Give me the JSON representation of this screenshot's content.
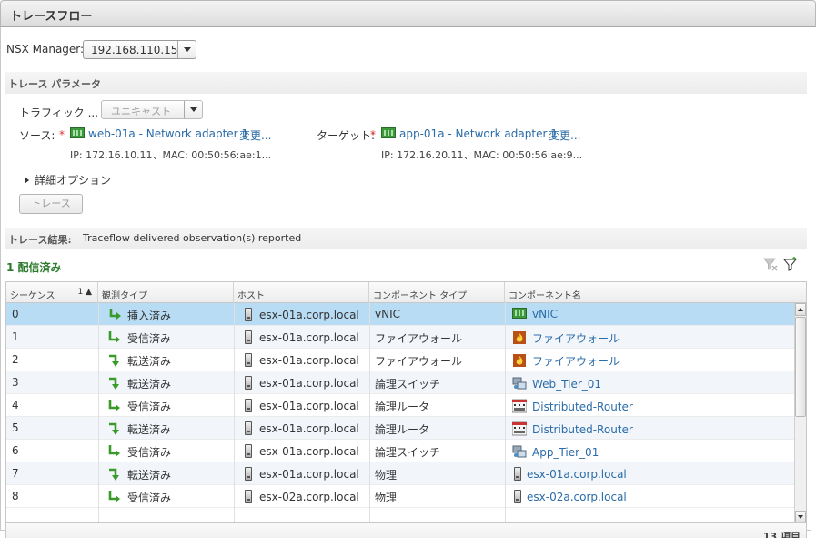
{
  "window": {
    "title": "トレースフロー"
  },
  "nsx": {
    "label": "NSX Manager:",
    "value": "192.168.110.15"
  },
  "params": {
    "section_title": "トレース パラメータ",
    "traffic_label": "トラフィック ...",
    "traffic_value": "ユニキャスト",
    "source_label": "ソース:",
    "source_required": "*",
    "source_link": "web-01a - Network adapter 1",
    "source_change": "変更...",
    "source_info": "IP: 172.16.10.11、MAC: 00:50:56:ae:1...",
    "target_label": "ターゲット:",
    "target_required": "*",
    "target_link": "app-01a - Network adapter 1",
    "target_change": "変更...",
    "target_info": "IP: 172.16.20.11、MAC: 00:50:56:ae:9...",
    "advanced_label": "詳細オプション",
    "trace_button": "トレース"
  },
  "results": {
    "label": "トレース結果:",
    "value": "Traceflow delivered observation(s) reported",
    "delivered": "1 配信済み"
  },
  "grid": {
    "columns": [
      "シーケンス",
      "観測タイプ",
      "ホスト",
      "コンポーネント タイプ",
      "コンポーネント名"
    ],
    "sort_indicator": "1 ▲",
    "rows": [
      {
        "seq": "0",
        "obs": "挿入済み",
        "obs_kind": "inject",
        "host": "esx-01a.corp.local",
        "ctype": "vNIC",
        "cname": "vNIC",
        "cicon": "vnic-icon"
      },
      {
        "seq": "1",
        "obs": "受信済み",
        "obs_kind": "receive",
        "host": "esx-01a.corp.local",
        "ctype": "ファイアウォール",
        "cname": "ファイアウォール",
        "cicon": "firewall-icon"
      },
      {
        "seq": "2",
        "obs": "転送済み",
        "obs_kind": "forward",
        "host": "esx-01a.corp.local",
        "ctype": "ファイアウォール",
        "cname": "ファイアウォール",
        "cicon": "firewall-icon"
      },
      {
        "seq": "3",
        "obs": "転送済み",
        "obs_kind": "forward",
        "host": "esx-01a.corp.local",
        "ctype": "論理スイッチ",
        "cname": "Web_Tier_01",
        "cicon": "logical-switch-icon"
      },
      {
        "seq": "4",
        "obs": "受信済み",
        "obs_kind": "receive",
        "host": "esx-01a.corp.local",
        "ctype": "論理ルータ",
        "cname": "Distributed-Router",
        "cicon": "router-icon"
      },
      {
        "seq": "5",
        "obs": "転送済み",
        "obs_kind": "forward",
        "host": "esx-01a.corp.local",
        "ctype": "論理ルータ",
        "cname": "Distributed-Router",
        "cicon": "router-icon"
      },
      {
        "seq": "6",
        "obs": "受信済み",
        "obs_kind": "receive",
        "host": "esx-01a.corp.local",
        "ctype": "論理スイッチ",
        "cname": "App_Tier_01",
        "cicon": "logical-switch-icon"
      },
      {
        "seq": "7",
        "obs": "転送済み",
        "obs_kind": "forward",
        "host": "esx-01a.corp.local",
        "ctype": "物理",
        "cname": "esx-01a.corp.local",
        "cicon": "host-icon"
      },
      {
        "seq": "8",
        "obs": "受信済み",
        "obs_kind": "receive",
        "host": "esx-02a.corp.local",
        "ctype": "物理",
        "cname": "esx-02a.corp.local",
        "cicon": "host-icon"
      }
    ],
    "count": "13 項目"
  },
  "colors": {
    "link": "#2a6ba8",
    "selected_row": "#b8dcf4",
    "delivered": "#2b7a2b",
    "arrow_green": "#3a9a2a"
  }
}
